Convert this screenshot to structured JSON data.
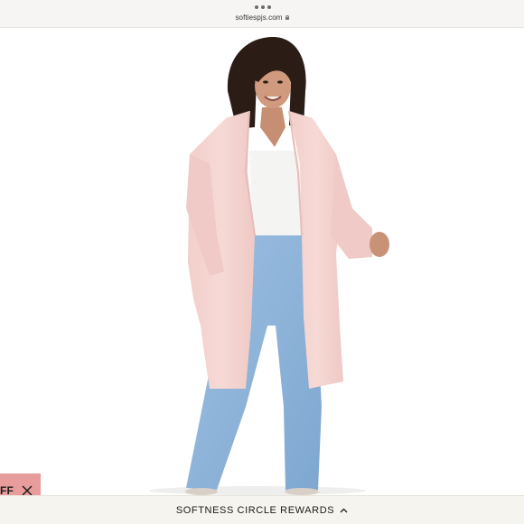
{
  "browser": {
    "url": "softiespjs.com",
    "icons": [
      "more-dots-icon",
      "lock-icon"
    ]
  },
  "product_image": {
    "description_icon": "model-photo"
  },
  "promo_tab": {
    "label": "FF",
    "close_icon": "close-icon",
    "background": "#e89c9c"
  },
  "rewards_bar": {
    "label": "SOFTNESS CIRCLE REWARDS",
    "icon": "chevron-up-icon",
    "background": "#f5f4ef"
  }
}
